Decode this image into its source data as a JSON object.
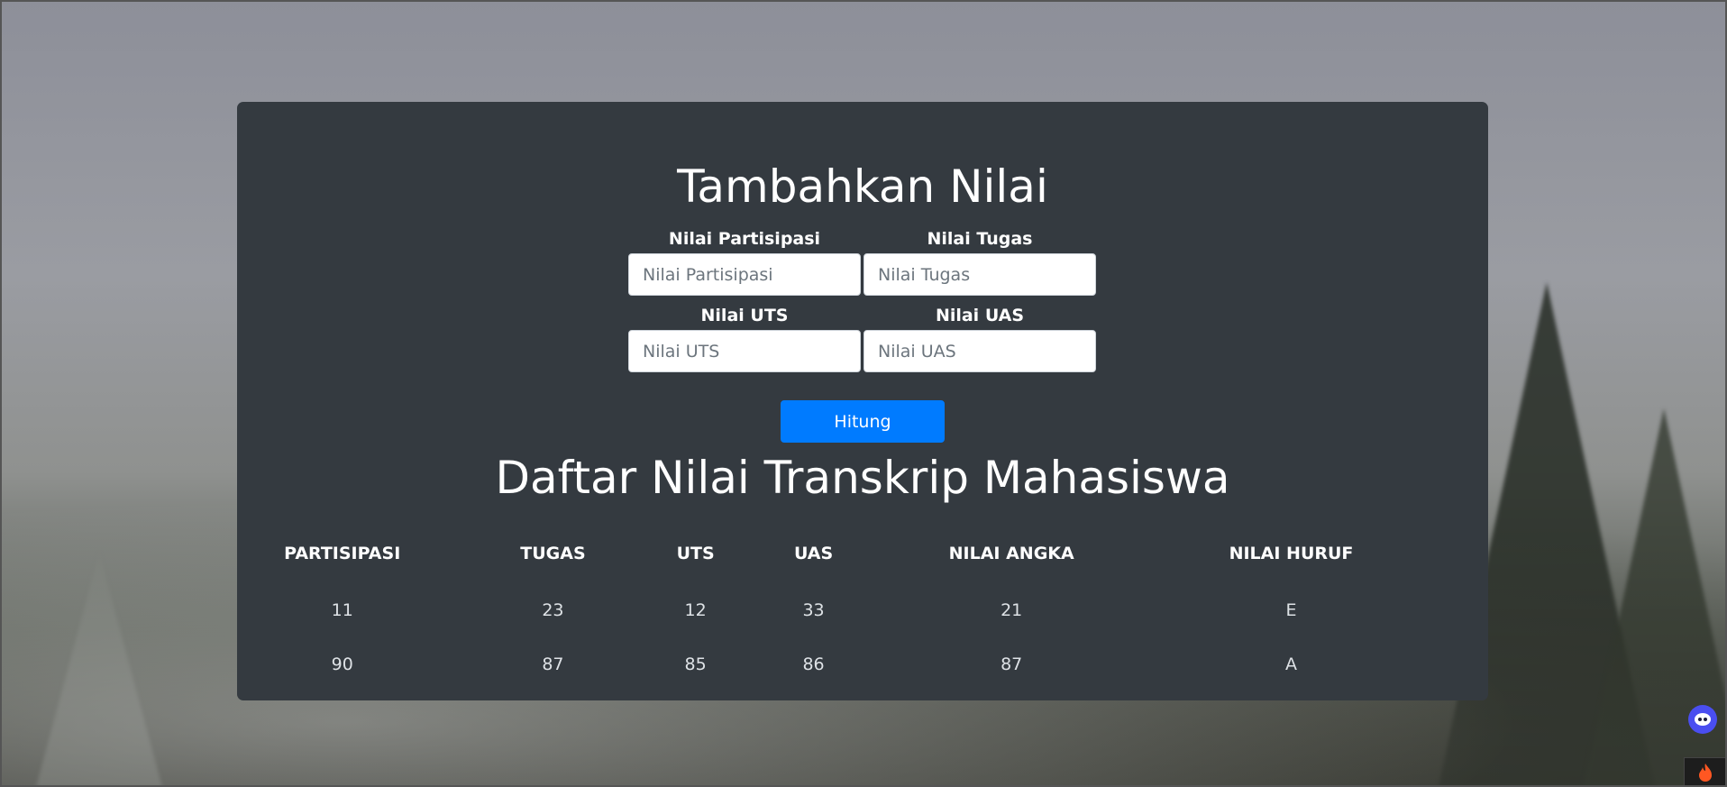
{
  "form": {
    "title": "Tambahkan Nilai",
    "fields": [
      {
        "label": "Nilai Partisipasi",
        "placeholder": "Nilai Partisipasi",
        "value": ""
      },
      {
        "label": "Nilai Tugas",
        "placeholder": "Nilai Tugas",
        "value": ""
      },
      {
        "label": "Nilai UTS",
        "placeholder": "Nilai UTS",
        "value": ""
      },
      {
        "label": "Nilai UAS",
        "placeholder": "Nilai UAS",
        "value": ""
      }
    ],
    "submit_label": "Hitung"
  },
  "table": {
    "title": "Daftar Nilai Transkrip Mahasiswa",
    "columns": [
      "PARTISIPASI",
      "TUGAS",
      "UTS",
      "UAS",
      "NILAI ANGKA",
      "NILAI HURUF"
    ],
    "rows": [
      [
        "11",
        "23",
        "12",
        "33",
        "21",
        "E"
      ],
      [
        "90",
        "87",
        "85",
        "86",
        "87",
        "A"
      ]
    ]
  },
  "floating": {
    "bot_icon": "robot-face-icon",
    "fire_icon": "fire-icon"
  },
  "colors": {
    "card_bg": "#343a40",
    "primary": "#007bff"
  }
}
